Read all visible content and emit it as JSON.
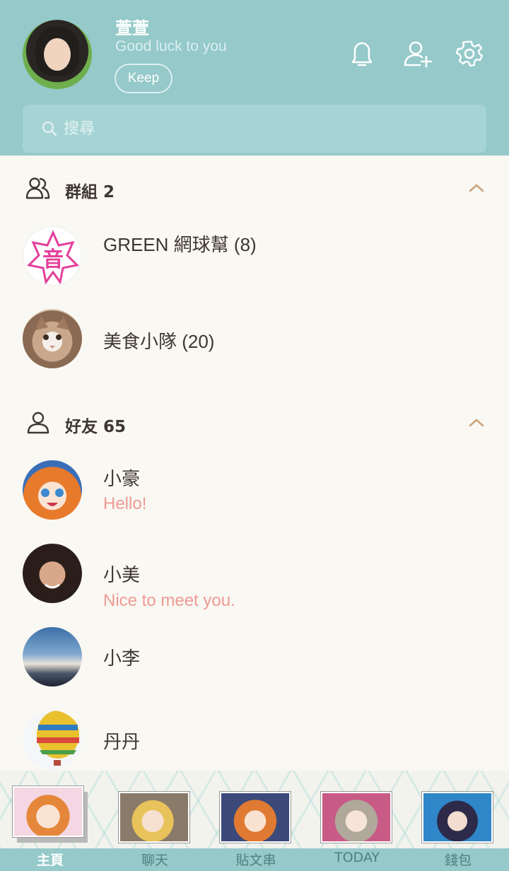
{
  "profile": {
    "name": "萱萱",
    "status": "Good luck to you",
    "keep_label": "Keep"
  },
  "search": {
    "placeholder": "搜尋"
  },
  "groups": {
    "title": "群組 2",
    "items": [
      {
        "name": "GREEN 網球幫 (8)"
      },
      {
        "name": "美食小隊 (20)"
      }
    ]
  },
  "friends": {
    "title": "好友 65",
    "items": [
      {
        "name": "小豪",
        "message": "Hello!"
      },
      {
        "name": "小美",
        "message": "Nice to meet you."
      },
      {
        "name": "小李",
        "message": ""
      },
      {
        "name": "丹丹",
        "message": ""
      }
    ]
  },
  "tabs": [
    {
      "label": "主頁",
      "active": true
    },
    {
      "label": "聊天",
      "active": false
    },
    {
      "label": "貼文串",
      "active": false
    },
    {
      "label": "TODAY",
      "active": false
    },
    {
      "label": "錢包",
      "active": false
    }
  ],
  "colors": {
    "header": "#95c9ca",
    "background": "#faf8f2",
    "status_message": "#ef9a94",
    "chevron": "#c9a47e"
  },
  "icons": [
    "bell-icon",
    "add-friend-icon",
    "gear-icon",
    "search-icon",
    "group-icon",
    "person-icon",
    "chevron-up-icon"
  ]
}
